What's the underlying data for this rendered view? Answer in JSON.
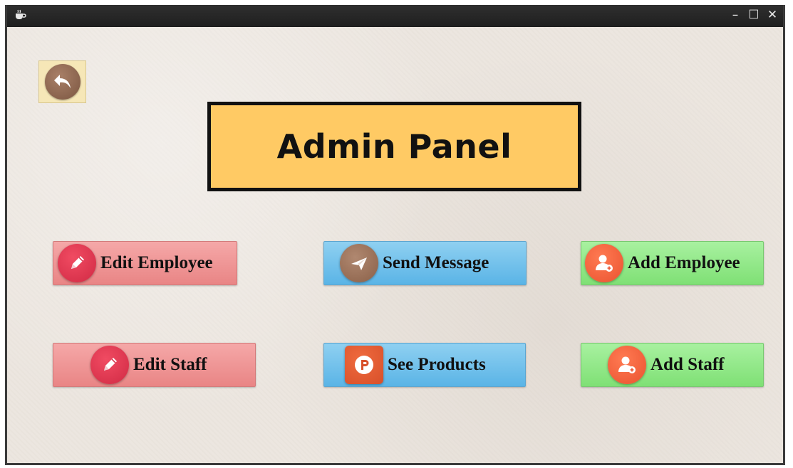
{
  "window": {
    "app_icon": "coffee-cup-icon",
    "controls": {
      "minimize": "–",
      "maximize": "☐",
      "close": "✕"
    }
  },
  "header": {
    "title": "Admin Panel"
  },
  "back_button": {
    "icon": "back-arrow-icon"
  },
  "buttons": {
    "edit_employee": {
      "label": "Edit Employee",
      "icon": "pencil-icon"
    },
    "send_message": {
      "label": "Send Message",
      "icon": "paper-plane-icon"
    },
    "add_employee": {
      "label": "Add Employee",
      "icon": "add-user-icon"
    },
    "edit_staff": {
      "label": "Edit Staff",
      "icon": "pencil-icon"
    },
    "see_products": {
      "label": "See Products",
      "icon": "product-hunt-icon"
    },
    "add_staff": {
      "label": "Add Staff",
      "icon": "add-user-icon"
    }
  },
  "colors": {
    "title_box": "#ffca64",
    "red_button": "#ef9999",
    "blue_button": "#6fc0ea",
    "green_button": "#90e886",
    "titlebar": "#262626"
  }
}
